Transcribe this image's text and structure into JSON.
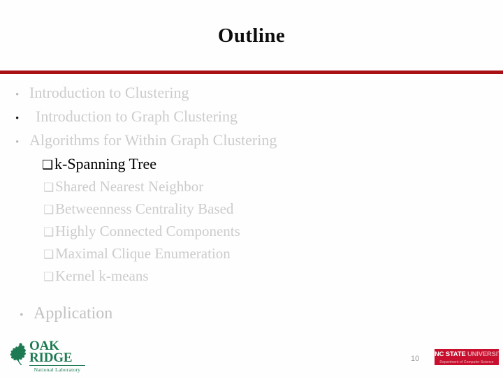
{
  "slide": {
    "title": "Outline",
    "page_number": "10",
    "accent_color": "#a81016",
    "dim_text_color": "#cccccc",
    "active_text_color": "#000000",
    "background_color": "#fefefe"
  },
  "outline": {
    "items": [
      {
        "level": 1,
        "marker": "•",
        "label": "Introduction to Clustering",
        "state": "dim",
        "marker_state": "dim"
      },
      {
        "level": 1,
        "marker": "•",
        "label": "Introduction to Graph Clustering",
        "state": "dim",
        "marker_state": "dark"
      },
      {
        "level": 1,
        "marker": "•",
        "label": "Algorithms for Within Graph Clustering",
        "state": "dim",
        "marker_state": "dim"
      },
      {
        "level": 2,
        "marker": "❑",
        "label": "k-Spanning Tree",
        "state": "active",
        "marker_state": "active"
      },
      {
        "level": 2,
        "marker": "❑",
        "label": "Shared Nearest Neighbor",
        "state": "dim",
        "marker_state": "dim"
      },
      {
        "level": 2,
        "marker": "❑",
        "label": "Betweenness Centrality Based",
        "state": "dim",
        "marker_state": "dim"
      },
      {
        "level": 2,
        "marker": "❑",
        "label": "Highly Connected Components",
        "state": "dim",
        "marker_state": "dim"
      },
      {
        "level": 2,
        "marker": "❑",
        "label": "Maximal Clique Enumeration",
        "state": "dim",
        "marker_state": "dim"
      },
      {
        "level": 2,
        "marker": "❑",
        "label": "Kernel k-means",
        "state": "dim",
        "marker_state": "dim"
      },
      {
        "level": 1,
        "marker": "•",
        "label": "Application",
        "state": "dim",
        "marker_state": "dim"
      }
    ]
  },
  "footer": {
    "ornl": {
      "line1": "OAK",
      "line2": "RIDGE",
      "subtitle": "National Laboratory",
      "color": "#1d7a52",
      "icon": "oak-leaf-icon"
    },
    "ncsu": {
      "name_bold": "NC STATE",
      "name_light": "UNIVERSITY",
      "department": "Department of Computer Science",
      "color": "#c8102e"
    }
  }
}
